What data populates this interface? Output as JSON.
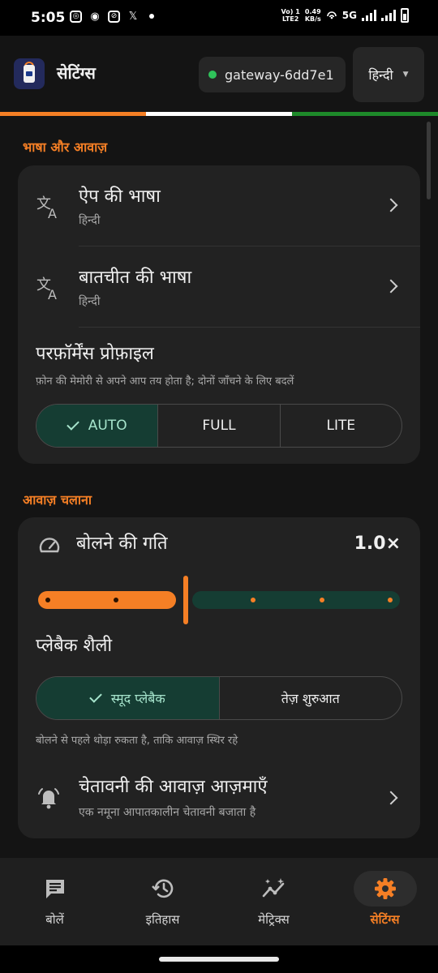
{
  "status_bar": {
    "time": "5:05",
    "net_top": "Vo) 1",
    "net_bottom": "LTE2",
    "speed_value": "0.49",
    "speed_unit": "KB/s",
    "network": "5G"
  },
  "app_bar": {
    "title": "सेटिंग्स",
    "gateway": "gateway-6dd7e1",
    "language": "हिन्दी"
  },
  "colors": {
    "accent": "#f57f25",
    "selected_bg": "#153d33",
    "selected_text": "#a6e4cc",
    "online": "#2fc25a",
    "tricolor": [
      "#f57f25",
      "#ffffff",
      "#1e8a2a"
    ]
  },
  "language_section": {
    "header": "भाषा और आवाज़",
    "app_language": {
      "title": "ऐप की भाषा",
      "value": "हिन्दी",
      "icon": "translate-icon"
    },
    "chat_language": {
      "title": "बातचीत की भाषा",
      "value": "हिन्दी",
      "icon": "translate-icon"
    },
    "performance": {
      "title": "परफ़ॉर्मेंस प्रोफ़ाइल",
      "description": "फ़ोन की मेमोरी से अपने आप तय होता है; दोनों जाँचने के लिए बदलें",
      "options": [
        "AUTO",
        "FULL",
        "LITE"
      ],
      "selected": "AUTO"
    }
  },
  "voice_section": {
    "header": "आवाज़ चलाना",
    "speech_rate": {
      "title": "बोलने की गति",
      "value": "1.0×",
      "level": 0.4,
      "steps": 6,
      "icon": "speedometer-icon"
    },
    "playback_style": {
      "title": "प्लेबैक शैली",
      "options": [
        "स्मूद प्लेबैक",
        "तेज़ शुरुआत"
      ],
      "selected": "स्मूद प्लेबैक",
      "description": "बोलने से पहले थोड़ा रुकता है, ताकि आवाज़ स्थिर रहे"
    },
    "alert_test": {
      "title": "चेतावनी की आवाज़ आज़माएँ",
      "subtitle": "एक नमूना आपातकालीन चेतावनी बजाता है",
      "icon": "bell-icon"
    }
  },
  "bottom_nav": {
    "items": [
      {
        "label": "बोलें",
        "icon": "chat-icon"
      },
      {
        "label": "इतिहास",
        "icon": "history-icon"
      },
      {
        "label": "मेट्रिक्स",
        "icon": "metrics-icon"
      },
      {
        "label": "सेटिंग्स",
        "icon": "gear-icon"
      }
    ],
    "active": "सेटिंग्स"
  }
}
